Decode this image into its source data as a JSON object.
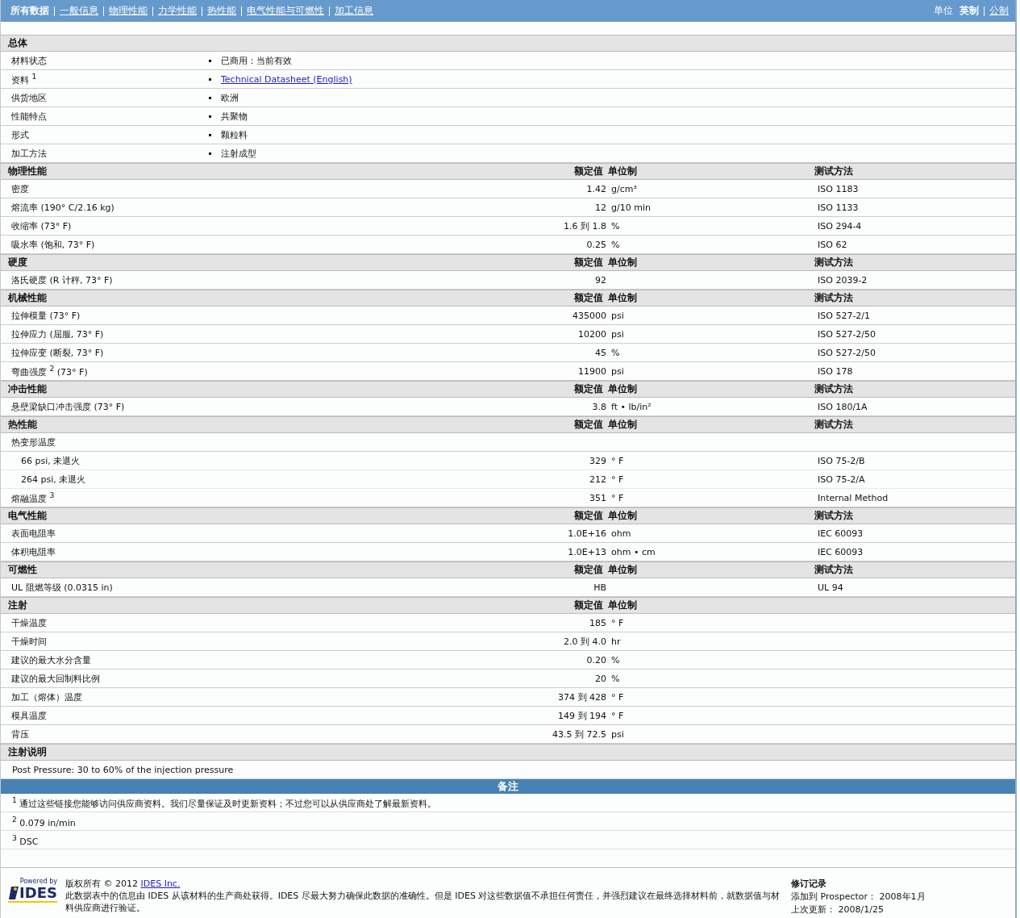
{
  "nav": {
    "tabs": [
      {
        "label": "所有数据",
        "selected": true
      },
      {
        "label": "一般信息",
        "selected": false
      },
      {
        "label": "物理性能",
        "selected": false
      },
      {
        "label": "力学性能",
        "selected": false
      },
      {
        "label": "热性能",
        "selected": false
      },
      {
        "label": "电气性能与可燃性",
        "selected": false
      },
      {
        "label": "加工信息",
        "selected": false
      }
    ],
    "units_label": "单位",
    "units": [
      {
        "label": "英制",
        "selected": true
      },
      {
        "label": "公制",
        "selected": false
      }
    ]
  },
  "general": {
    "title": "总体",
    "rows": [
      {
        "label": "材料状态",
        "value": "已商用：当前有效",
        "kind": "text"
      },
      {
        "label": "资料 $^{1}$",
        "value": "Technical Datasheet (English)",
        "kind": "link"
      },
      {
        "label": "供货地区",
        "value": "欧洲",
        "kind": "text"
      },
      {
        "label": "性能特点",
        "value": "共聚物",
        "kind": "text"
      },
      {
        "label": "形式",
        "value": "颗粒料",
        "kind": "text"
      },
      {
        "label": "加工方法",
        "value": "注射成型",
        "kind": "text"
      }
    ]
  },
  "sections": [
    {
      "title": "物理性能",
      "value_header": "额定值",
      "unit_header": "单位制",
      "method_header": "测试方法",
      "rows": [
        {
          "label": "密度",
          "value": "1.42",
          "unit": "g/cm³",
          "method": "ISO 1183"
        },
        {
          "label": "熔流率  (190° C/2.16 kg)",
          "value": "12",
          "unit": "g/10 min",
          "method": "ISO 1133"
        },
        {
          "label": "收缩率  (73° F)",
          "value": "1.6 到  1.8",
          "unit": "%",
          "method": "ISO 294-4"
        },
        {
          "label": "吸水率  (饱和, 73° F)",
          "value": "0.25",
          "unit": "%",
          "method": "ISO 62"
        }
      ]
    },
    {
      "title": "硬度",
      "value_header": "额定值",
      "unit_header": "单位制",
      "method_header": "测试方法",
      "rows": [
        {
          "label": "洛氏硬度  (R 计秤, 73° F)",
          "value": "92",
          "method": "ISO 2039-2"
        }
      ]
    },
    {
      "title": "机械性能",
      "value_header": "额定值",
      "unit_header": "单位制",
      "method_header": "测试方法",
      "rows": [
        {
          "label": "拉伸模量  (73° F)",
          "value": "435000",
          "unit": "psi",
          "method": "ISO 527-2/1"
        },
        {
          "label": "拉伸应力  (屈服, 73° F)",
          "value": "10200",
          "unit": "psi",
          "method": "ISO 527-2/50"
        },
        {
          "label": "拉伸应变  (断裂, 73° F)",
          "value": "45",
          "unit": "%",
          "method": "ISO 527-2/50"
        },
        {
          "label": "弯曲强度 $^{2}$ (73° F)",
          "value": "11900",
          "unit": "psi",
          "method": "ISO 178"
        }
      ]
    },
    {
      "title": "冲击性能",
      "value_header": "额定值",
      "unit_header": "单位制",
      "method_header": "测试方法",
      "rows": [
        {
          "label": "悬壁梁缺口冲击强度  (73° F)",
          "value": "3.8",
          "unit": "ft • lb/in²",
          "method": "ISO 180/1A"
        }
      ]
    },
    {
      "title": "热性能",
      "value_header": "额定值",
      "unit_header": "单位制",
      "method_header": "测试方法",
      "rows": [
        {
          "label": "热变形温度",
          "children": [
            {
              "label": "66 psi, 未退火",
              "value": "329",
              "unit": "° F",
              "method": "ISO 75-2/B"
            },
            {
              "label": "264 psi, 未退火",
              "value": "212",
              "unit": "° F",
              "method": "ISO 75-2/A"
            }
          ]
        },
        {
          "label": "熔融温度 $^{3}$",
          "value": "351",
          "unit": "° F",
          "method": "Internal Method"
        }
      ]
    },
    {
      "title": "电气性能",
      "value_header": "额定值",
      "unit_header": "单位制",
      "method_header": "测试方法",
      "rows": [
        {
          "label": "表面电阻率",
          "value": "1.0E+16",
          "unit": "ohm",
          "method": "IEC 60093"
        },
        {
          "label": "体积电阻率",
          "value": "1.0E+13",
          "unit": "ohm • cm",
          "method": "IEC 60093"
        }
      ]
    },
    {
      "title": "可燃性",
      "value_header": "额定值",
      "unit_header": "单位制",
      "method_header": "测试方法",
      "rows": [
        {
          "label": "UL 阻燃等级  (0.0315 in)",
          "value": "HB",
          "method": "UL 94"
        }
      ]
    },
    {
      "title": "注射",
      "value_header": "额定值",
      "unit_header": "单位制",
      "rows": [
        {
          "label": "干燥温度",
          "value": "185",
          "unit": "° F"
        },
        {
          "label": "干燥时间",
          "value": "2.0 到  4.0",
          "unit": "hr"
        },
        {
          "label": "建议的最大水分含量",
          "value": "0.20",
          "unit": "%"
        },
        {
          "label": "建议的最大回制料比例",
          "value": "20",
          "unit": "%"
        },
        {
          "label": "加工（熔体）温度",
          "value": "374 到  428",
          "unit": "° F"
        },
        {
          "label": "模具温度",
          "value": "149 到  194",
          "unit": "° F"
        },
        {
          "label": "背压",
          "value": "43.5 到  72.5",
          "unit": "psi"
        }
      ]
    }
  ],
  "injection_notes": {
    "title": "注射说明",
    "text": "Post Pressure: 30 to 60% of the injection pressure"
  },
  "remarks": {
    "title": "备注",
    "notes": [
      {
        "mark": "1",
        "text": "通过这些链接您能够访问供应商资料。我们尽量保证及时更新资料；不过您可以从供应商处了解最新资料。"
      },
      {
        "mark": "2",
        "text": "0.079 in/min"
      },
      {
        "mark": "3",
        "text": "DSC"
      }
    ]
  },
  "footer": {
    "logo_top": "Powered by",
    "logo_text": "IDES",
    "copyright": "版权所有  © 2012",
    "company": "IDES Inc.",
    "disclaimer": "此数据表中的信息由  IDES 从该材料的生产商处获得。IDES 尽最大努力确保此数据的准确性。但是  IDES 对这些数据值不承担任何责任，并强烈建议在最终选择材料前，就数据值与材料供应商进行验证。",
    "revision_title": "修订记录",
    "added": "添加到  Prospector：  2008年1月",
    "updated": "上次更新：  2008/1/25"
  }
}
